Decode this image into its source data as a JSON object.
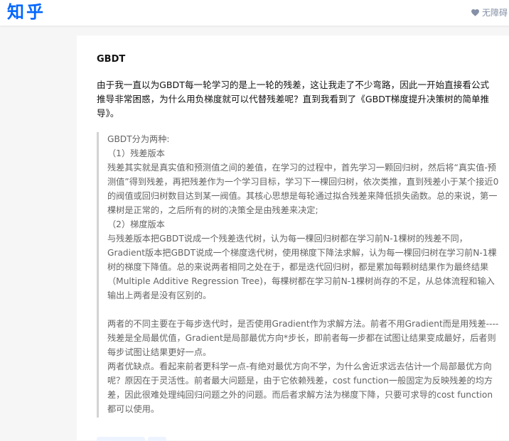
{
  "header": {
    "logo": "知乎",
    "accessibility_label": "无障碍"
  },
  "article": {
    "title": "GBDT",
    "intro": "由于我一直以为GBDT每一轮学习的是上一轮的残差，这让我走了不少弯路，因此一开始直接看公式推导非常困惑，为什么用负梯度就可以代替残差呢？直到我看到了《GBDT梯度提升决策树的简单推导》。",
    "quote": [
      "GBDT分为两种:",
      "（1）残差版本",
      "残差其实就是真实值和预测值之间的差值，在学习的过程中，首先学习一颗回归树，然后将“真实值-预测值”得到残差，再把残差作为一个学习目标，学习下一棵回归树，依次类推，直到残差小于某个接近0的阀值或回归树数目达到某一阀值。其核心思想是每轮通过拟合残差来降低损失函数。总的来说，第一棵树是正常的，之后所有的树的决策全是由残差来决定;",
      "（2）梯度版本",
      "与残差版本把GBDT说成一个残差迭代树，认为每一棵回归树都在学习前N-1棵树的残差不同，Gradient版本把GBDT说成一个梯度迭代树，使用梯度下降法求解，认为每一棵回归树在学习前N-1棵树的梯度下降值。总的来说两者相同之处在于，都是迭代回归树，都是累加每颗树结果作为最终结果（Multiple Additive Regression Tree)，每棵树都在学习前N-1棵树尚存的不足，从总体流程和输入输出上两者是没有区别的。",
      "",
      "两者的不同主要在于每步迭代时，是否使用Gradient作为求解方法。前者不用Gradient而是用残差----残差是全局最优值，Gradient是局部最优方向*步长，即前者每一步都在试图让结果变成最好，后者则每步试图让结果更好一点。",
      "两者优缺点。看起来前者更科学一点-有绝对最优方向不学，为什么舍近求远去估计一个局部最优方向呢？原因在于灵活性。前者最大问题是，由于它依赖残差，cost function一般固定为反映残差的均方差，因此很难处理纯回归问题之外的问题。而后者求解方法为梯度下降，只要可求导的cost function都可以使用。"
    ]
  },
  "colors": {
    "brand": "#0066ff",
    "muted": "#8590a6",
    "quote_text": "#646464",
    "quote_border": "#d3d3d3",
    "page_bg": "#f6f6f6"
  },
  "icons": {
    "accessibility": "heart-icon"
  }
}
